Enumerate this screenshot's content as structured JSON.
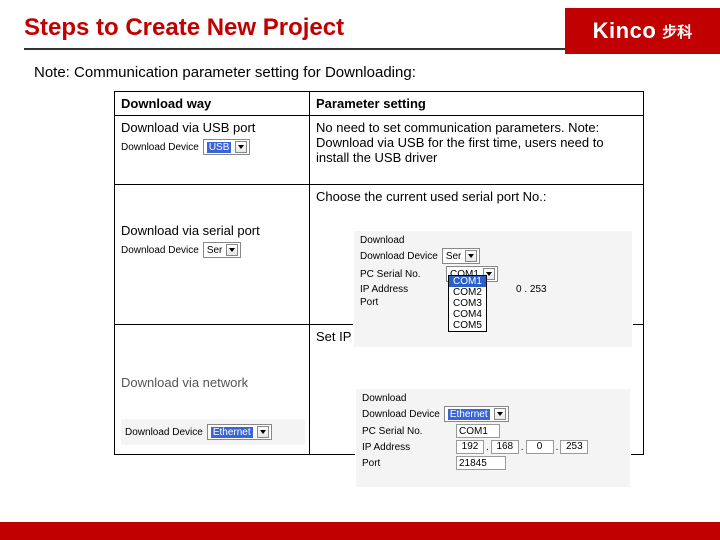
{
  "title": "Steps to Create New Project",
  "logo": {
    "brand": "Kinco",
    "cn": "步科"
  },
  "note": "Note: Communication parameter setting for Downloading:",
  "table": {
    "headers": {
      "left": "Download  way",
      "right": "Parameter setting"
    },
    "row_usb": {
      "left_title": "Download via USB port",
      "device_label": "Download Device",
      "device_value": "USB",
      "right_text": "No need to set communication parameters. Note: Download via USB for the first time, users need to install the USB driver"
    },
    "row_serial": {
      "left_title": "Download via serial port",
      "device_label": "Download Device",
      "device_value": "Ser",
      "right_text": "Choose the current used serial port No.:"
    },
    "row_net": {
      "left_title": "Download via network",
      "device_label": "Download Device",
      "device_value": "Ethernet",
      "right_text": "Set IP address and port number of the"
    }
  },
  "serial_panel": {
    "group": "Download",
    "device_label": "Download Device",
    "device_value": "Ser",
    "pc_serial_label": "PC Serial No.",
    "pc_serial_value": "COM1",
    "options": [
      "COM1",
      "COM2",
      "COM3",
      "COM4",
      "COM5"
    ],
    "ip_label": "IP Address",
    "extra_label": "0 . 253",
    "port_label": "Port"
  },
  "net_panel": {
    "group": "Download",
    "device_label": "Download Device",
    "device_value": "Ethernet",
    "pc_serial_label": "PC Serial No.",
    "pc_serial_value": "COM1",
    "ip_label": "IP Address",
    "ip": [
      "192",
      "168",
      "0",
      "253"
    ],
    "port_label": "Port",
    "port_value": "21845"
  }
}
